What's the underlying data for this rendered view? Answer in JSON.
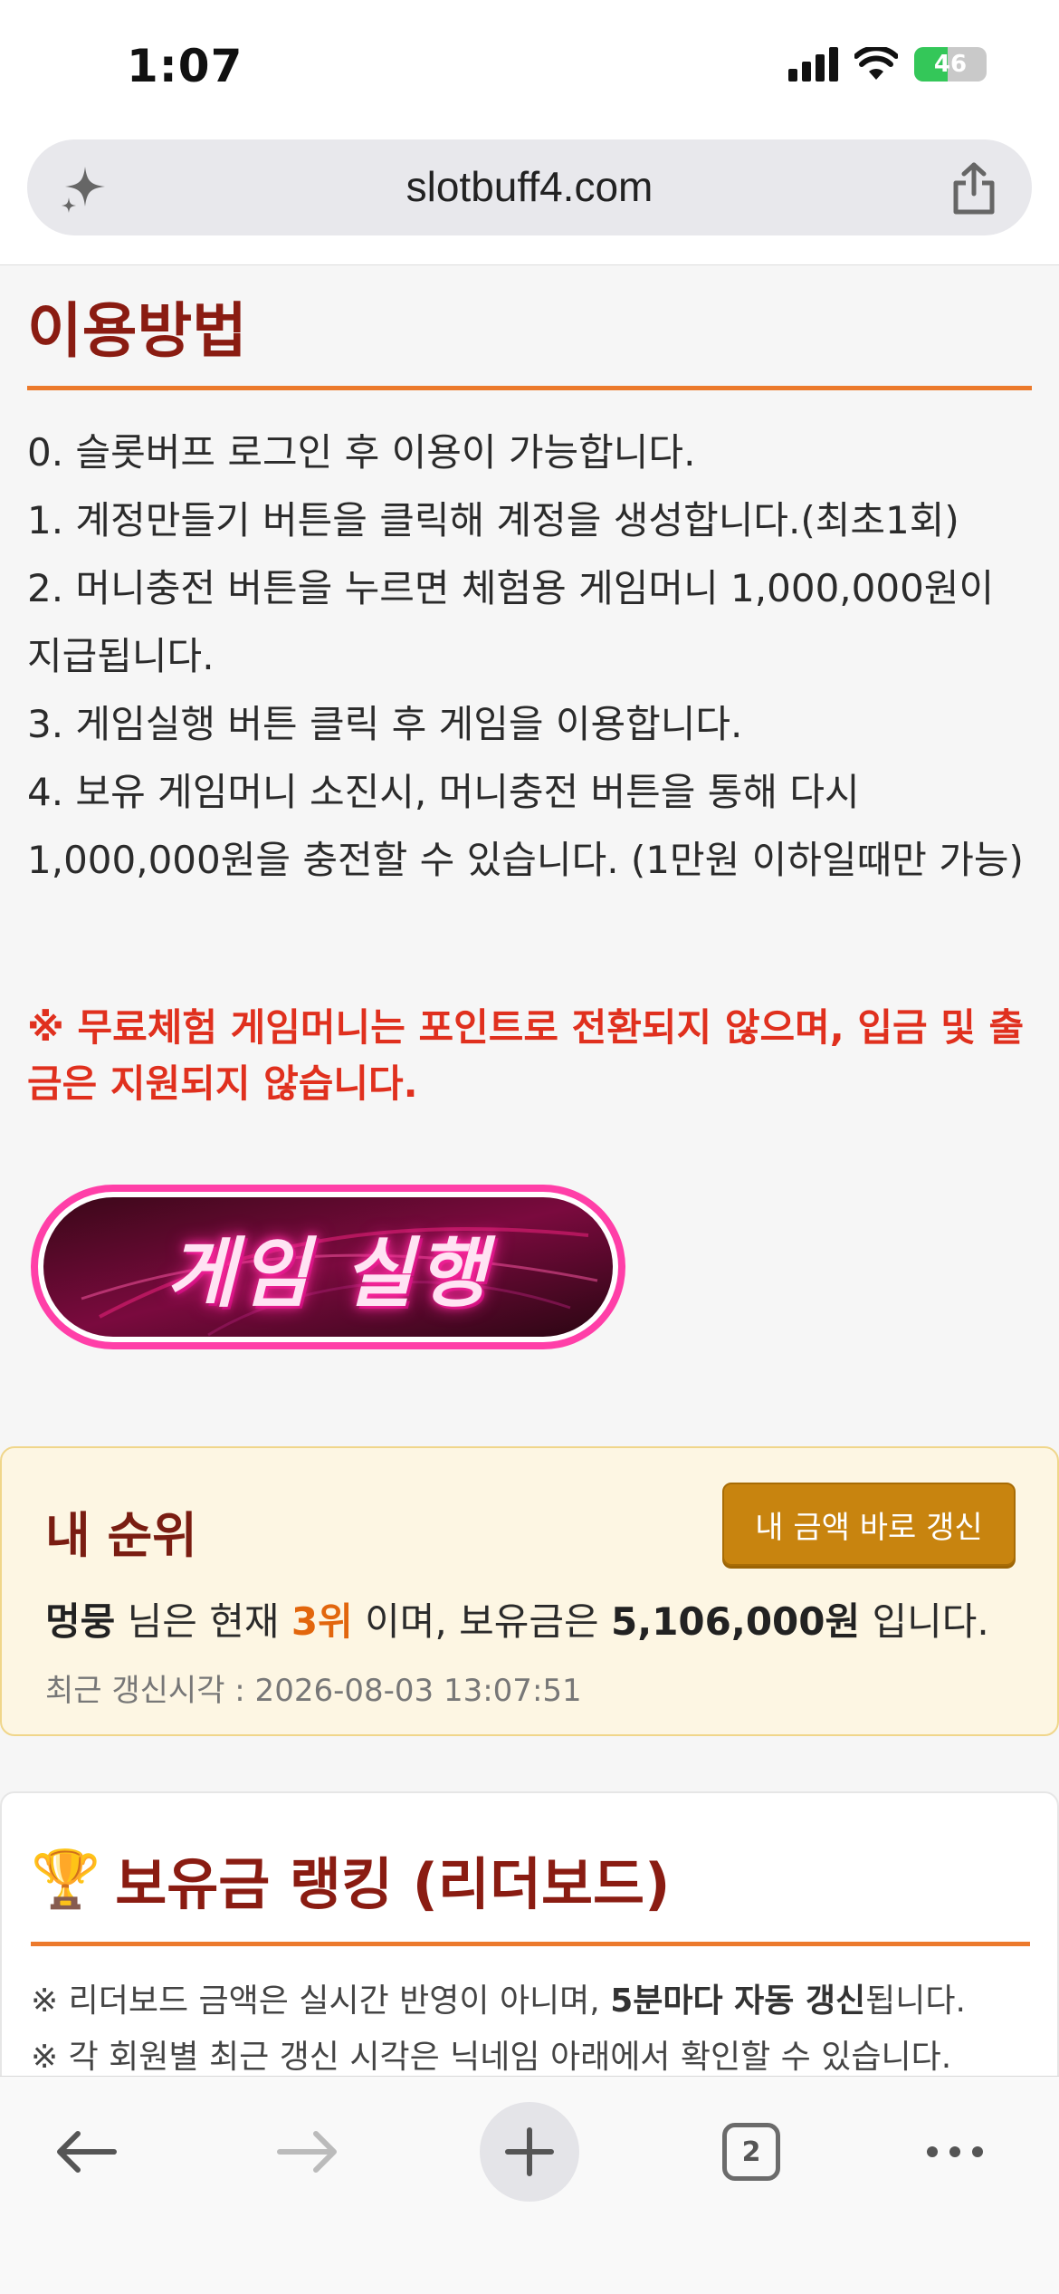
{
  "status_bar": {
    "time": "1:07",
    "battery": "46",
    "battery_level": 0.46
  },
  "browser": {
    "url": "slotbuff4.com",
    "tabs_count": "2"
  },
  "usage": {
    "title": "이용방법",
    "steps": [
      "0. 슬롯버프 로그인 후 이용이 가능합니다.",
      "1. 계정만들기 버튼을 클릭해 계정을 생성합니다.(최초1회)",
      "2. 머니충전 버튼을 누르면 체험용 게임머니 1,000,000원이 지급됩니다.",
      "3. 게임실행 버튼 클릭 후 게임을 이용합니다.",
      "4. 보유 게임머니 소진시, 머니충전 버튼을 통해 다시 1,000,000원을 충전할 수 있습니다. (1만원 이하일때만 가능)"
    ],
    "warning": "※ 무료체험 게임머니는 포인트로 전환되지 않으며, 입금 및 출금은 지원되지 않습니다.",
    "game_button": "게임 실행"
  },
  "my_rank": {
    "title": "내 순위",
    "refresh_button": "내 금액 바로 갱신",
    "nickname": "멍뭉",
    "text_1": " 님은 현재 ",
    "rank": "3위",
    "text_2": " 이며, 보유금은 ",
    "amount": "5,106,000원",
    "text_3": " 입니다.",
    "updated": "최근 갱신시각 : 2026-08-03 13:07:51"
  },
  "leaderboard": {
    "title": "보유금 랭킹 (리더보드)",
    "note_1_prefix": "※ 리더보드 금액은 실시간 반영이 아니며, ",
    "note_1_bold": "5분마다 자동 갱신",
    "note_1_suffix": "됩니다.",
    "note_2": "※ 각 회원별 최근 갱신 시각은 닉네임 아래에서 확인할 수 있습니다."
  },
  "colors": {
    "accent": "#ec7a2c",
    "title": "#8a1c12",
    "warning": "#e0301e",
    "rank": "#e2660d",
    "button": "#c8840f"
  }
}
